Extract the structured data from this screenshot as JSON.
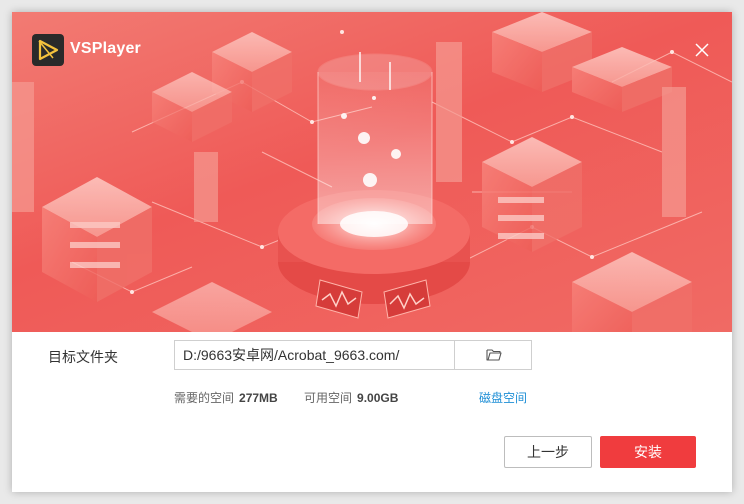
{
  "header": {
    "app_title": "VSPlayer",
    "logo_icon": "vsplayer-logo-icon",
    "close_icon": "close-icon",
    "accent": "#f06461"
  },
  "install": {
    "folder_label": "目标文件夹",
    "path_value": "D:/9663安卓网/Acrobat_9663.com/",
    "browse_icon": "folder-open-icon",
    "required_label": "需要的空间",
    "required_value": "277MB",
    "available_label": "可用空间",
    "available_value": "9.00GB",
    "disk_space_link": "磁盘空间",
    "link_color": "#1f8fd6"
  },
  "buttons": {
    "back_label": "上一步",
    "install_label": "安装",
    "install_color": "#f03c3e"
  }
}
